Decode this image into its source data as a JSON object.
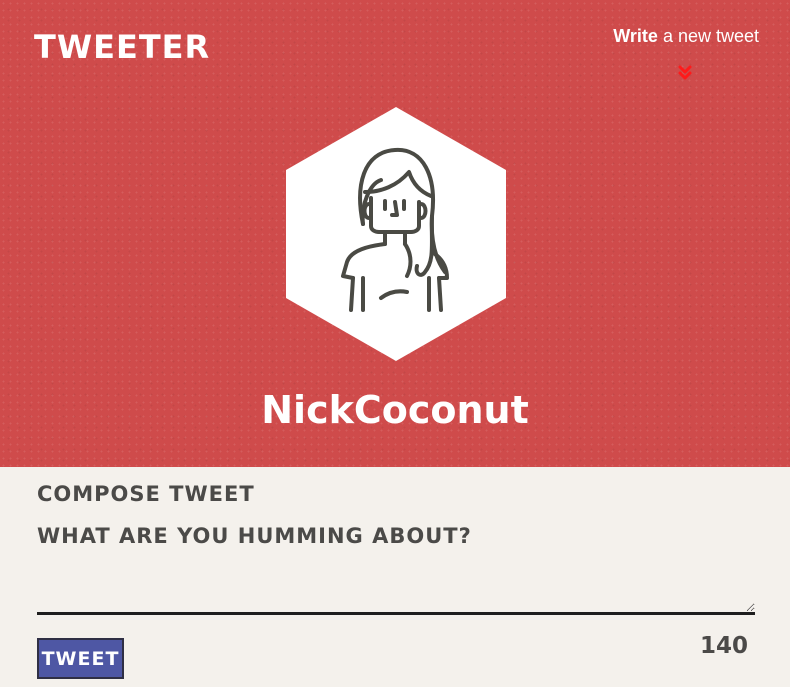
{
  "header": {
    "logo_text": "Tweeter",
    "nav_write_bold": "Write",
    "nav_write_rest": " a new tweet",
    "chevron_icon": "double-chevron-down-icon",
    "chevron_color": "#ff1a1a"
  },
  "profile": {
    "avatar_icon": "user-avatar-icon",
    "name": "NickCoconut"
  },
  "compose": {
    "title": "Compose Tweet",
    "label": "What are you humming about?",
    "input_value": "",
    "button_label": "Tweet",
    "char_counter": "140"
  },
  "colors": {
    "hero_bg": "#cf4b4b",
    "page_bg": "#f4f1ec",
    "button_bg": "#4e57a4",
    "heading_text": "#4b4a48"
  }
}
